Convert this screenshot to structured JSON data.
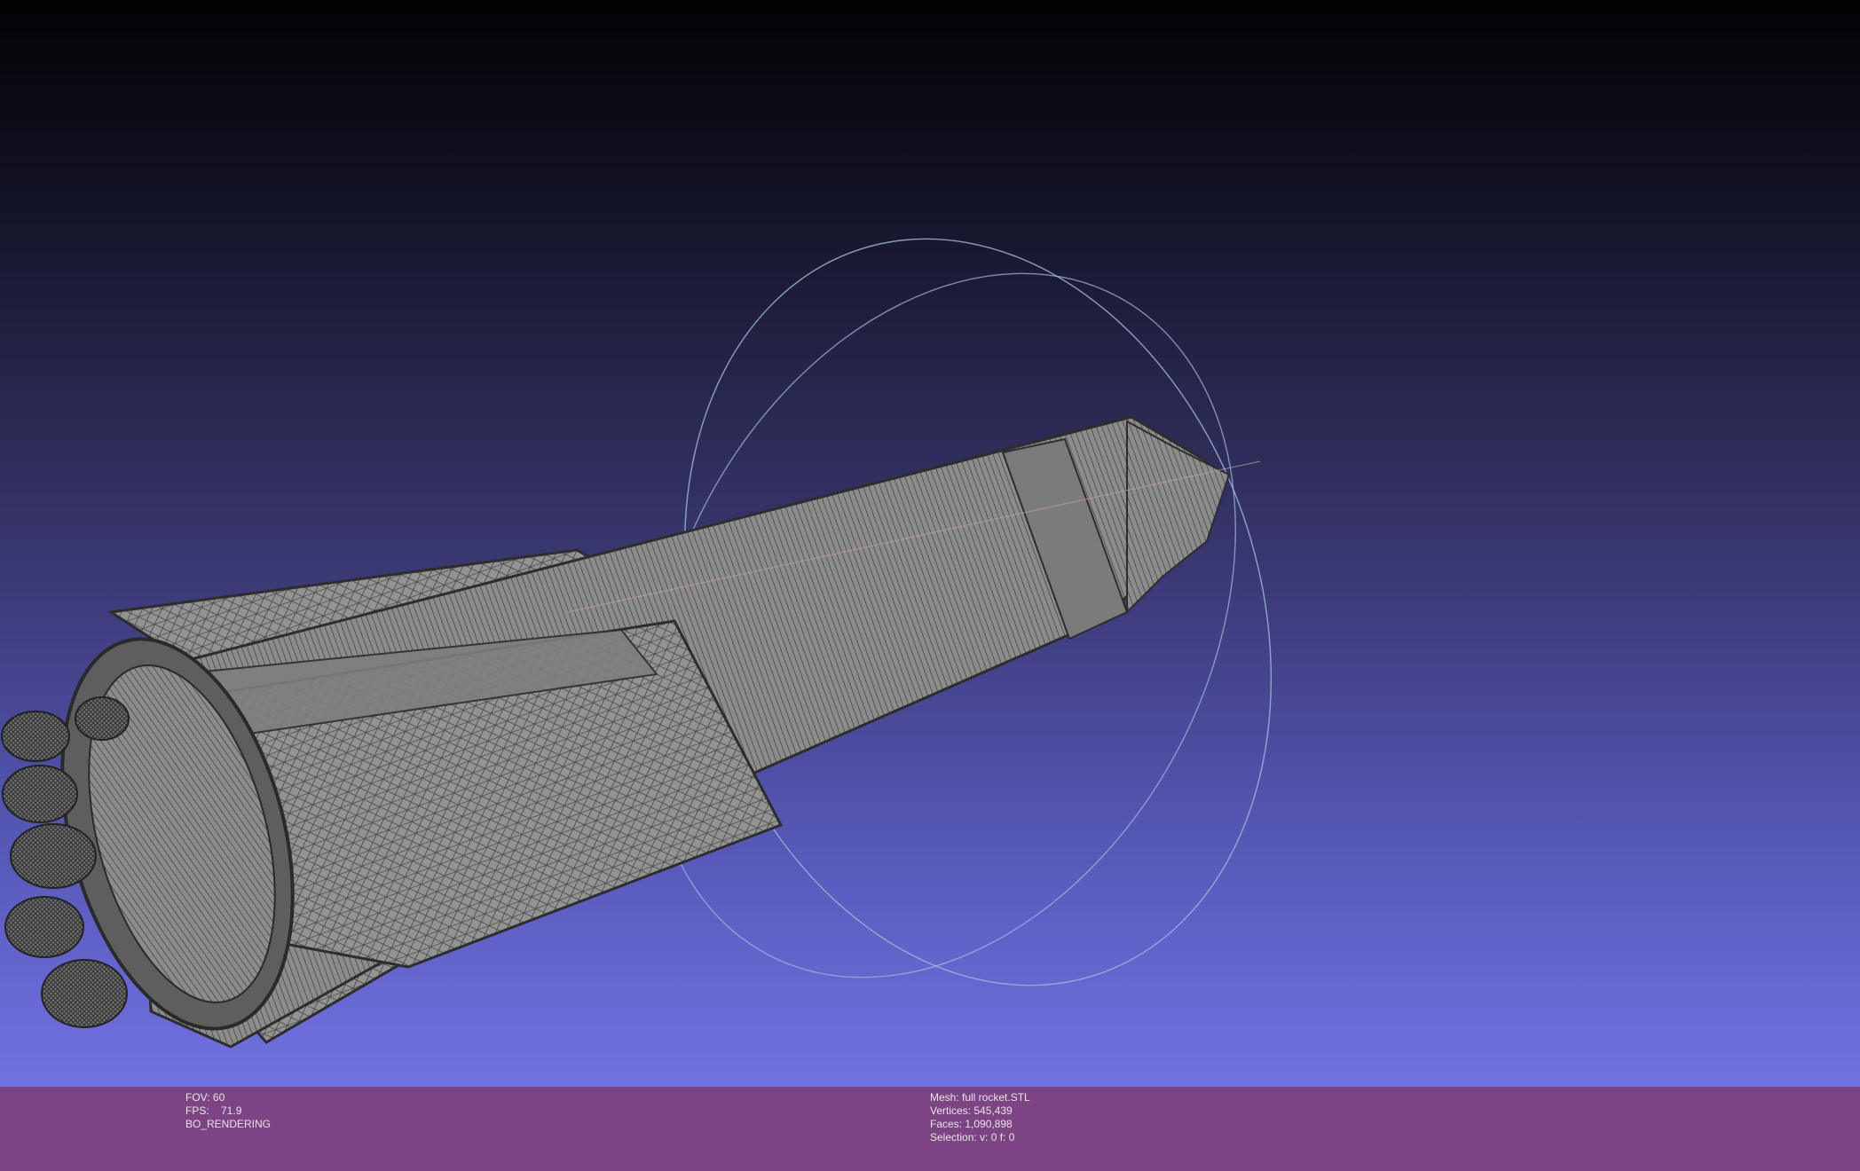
{
  "viewport": {
    "background_top": "#020204",
    "background_bottom": "#7172e3",
    "mesh_color": "#8a8a8a",
    "wire_color": "#3a3a3a",
    "trackball_color": "#9fb6d8",
    "axis_color": "#c59aa0"
  },
  "info_left": {
    "fov": "FOV: 60",
    "fps": "FPS:    71.9",
    "mode": "BO_RENDERING"
  },
  "info_right": {
    "mesh": "Mesh: full rocket.STL",
    "vertices": "Vertices: 545,439",
    "faces": "Faces: 1,090,898",
    "selection": "Selection: v: 0 f: 0"
  },
  "info_bar_color": "#7d4484"
}
